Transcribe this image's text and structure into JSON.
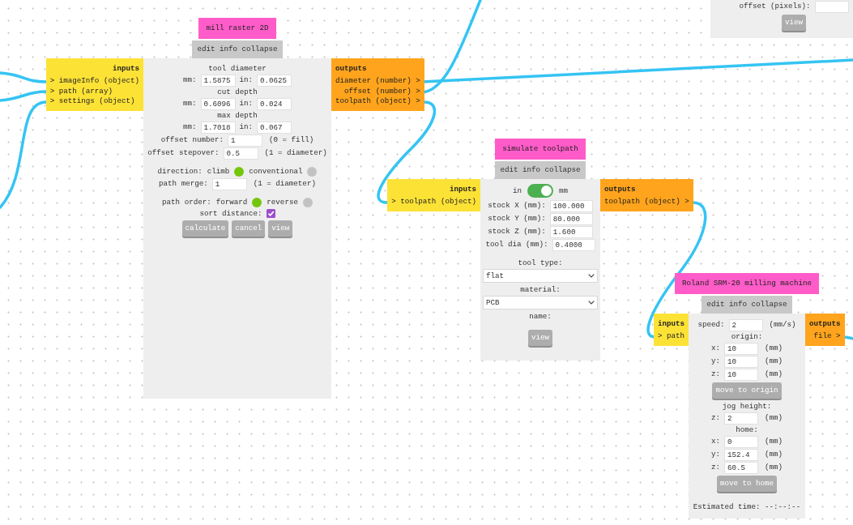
{
  "modules": [
    {
      "title": "mill raster 2D",
      "menu": [
        "edit",
        "info",
        "collapse"
      ],
      "inputs": {
        "heading": "inputs",
        "ports": [
          "> imageInfo (object)",
          "> path (array)",
          "> settings (object)"
        ]
      },
      "outputs": {
        "heading": "outputs",
        "ports": [
          "diameter (number) >",
          "offset (number) >",
          "toolpath (object) >"
        ]
      },
      "sections": [
        [
          {
            "kind": "label",
            "text": "tool diameter"
          },
          {
            "kind": "pair",
            "fields": [
              {
                "label": "mm:",
                "value": "1.5875"
              },
              {
                "label": "in:",
                "value": "0.0625"
              }
            ]
          },
          {
            "kind": "label",
            "text": "cut depth"
          },
          {
            "kind": "pair",
            "fields": [
              {
                "label": "mm:",
                "value": "0.6096"
              },
              {
                "label": "in:",
                "value": "0.024"
              }
            ]
          },
          {
            "kind": "label",
            "text": "max depth"
          },
          {
            "kind": "pair",
            "fields": [
              {
                "label": "mm:",
                "value": "1.7018"
              },
              {
                "label": "in:",
                "value": "0.067"
              }
            ]
          },
          {
            "kind": "field",
            "label": "offset number:",
            "value": "1",
            "note": "(0 = fill)"
          },
          {
            "kind": "field",
            "label": "offset stepover:",
            "value": "0.5",
            "note": "(1 = diameter)"
          }
        ],
        [
          {
            "kind": "radio",
            "label": "direction:",
            "options": [
              {
                "label": "climb",
                "selected": true
              },
              {
                "label": "conventional",
                "selected": false
              }
            ]
          },
          {
            "kind": "field",
            "label": "path merge:",
            "value": "1",
            "note": "(1 = diameter)"
          }
        ],
        [
          {
            "kind": "radio",
            "label": "path order:",
            "options": [
              {
                "label": "forward",
                "selected": true
              },
              {
                "label": "reverse",
                "selected": false
              }
            ]
          },
          {
            "kind": "checkbox",
            "label": "sort distance:",
            "checked": true
          },
          {
            "kind": "buttons",
            "buttons": [
              "calculate",
              "cancel",
              "view"
            ]
          }
        ]
      ]
    },
    {
      "title": "simulate toolpath",
      "menu": [
        "edit",
        "info",
        "collapse"
      ],
      "inputs": {
        "heading": "inputs",
        "ports": [
          "> toolpath (object)"
        ]
      },
      "outputs": {
        "heading": "outputs",
        "ports": [
          "toolpath (object) >"
        ]
      },
      "sections": [
        [
          {
            "kind": "toggle",
            "left": "in",
            "right": "mm",
            "on": true
          },
          {
            "kind": "field",
            "label": "stock X (mm):",
            "value": "100.000"
          },
          {
            "kind": "field",
            "label": "stock Y (mm):",
            "value": "80.000"
          },
          {
            "kind": "field",
            "label": "stock Z (mm):",
            "value": "1.600"
          },
          {
            "kind": "field",
            "label": "tool dia (mm):",
            "value": "0.4000"
          }
        ],
        [
          {
            "kind": "label",
            "text": "tool type:"
          },
          {
            "kind": "select",
            "value": "flat"
          },
          {
            "kind": "label",
            "text": "material:"
          },
          {
            "kind": "select",
            "value": "PCB"
          },
          {
            "kind": "label",
            "text": "name:"
          }
        ],
        [
          {
            "kind": "buttons",
            "buttons": [
              "view"
            ]
          }
        ]
      ]
    },
    {
      "title": "Roland SRM-20 milling machine",
      "menu": [
        "edit",
        "info",
        "collapse"
      ],
      "inputs": {
        "heading": "inputs",
        "ports": [
          "> path"
        ]
      },
      "outputs": {
        "heading": "outputs",
        "ports": [
          "file >"
        ]
      },
      "sections": [
        [
          {
            "kind": "field",
            "label": "speed:",
            "value": "2",
            "note": "(mm/s)"
          },
          {
            "kind": "label",
            "text": "origin:"
          },
          {
            "kind": "field",
            "label": "x:",
            "value": "10",
            "note": "(mm)"
          },
          {
            "kind": "field",
            "label": "y:",
            "value": "10",
            "note": "(mm)"
          },
          {
            "kind": "field",
            "label": "z:",
            "value": "10",
            "note": "(mm)"
          },
          {
            "kind": "buttons",
            "buttons": [
              "move to origin"
            ]
          },
          {
            "kind": "label",
            "text": "jog height:"
          },
          {
            "kind": "field",
            "label": "z:",
            "value": "2",
            "note": "(mm)"
          },
          {
            "kind": "label",
            "text": "home:"
          },
          {
            "kind": "field",
            "label": "x:",
            "value": "0",
            "note": "(mm)"
          },
          {
            "kind": "field",
            "label": "y:",
            "value": "152.4",
            "note": "(mm)"
          },
          {
            "kind": "field",
            "label": "z:",
            "value": "60.5",
            "note": "(mm)"
          },
          {
            "kind": "buttons",
            "buttons": [
              "move to home"
            ]
          }
        ],
        [
          {
            "kind": "text",
            "text": "Estimated time: --:--:--"
          }
        ]
      ]
    },
    {
      "sections": [
        [
          {
            "kind": "field",
            "label": "offset (pixels):"
          },
          {
            "kind": "buttons",
            "buttons": [
              "view"
            ]
          }
        ]
      ]
    }
  ]
}
